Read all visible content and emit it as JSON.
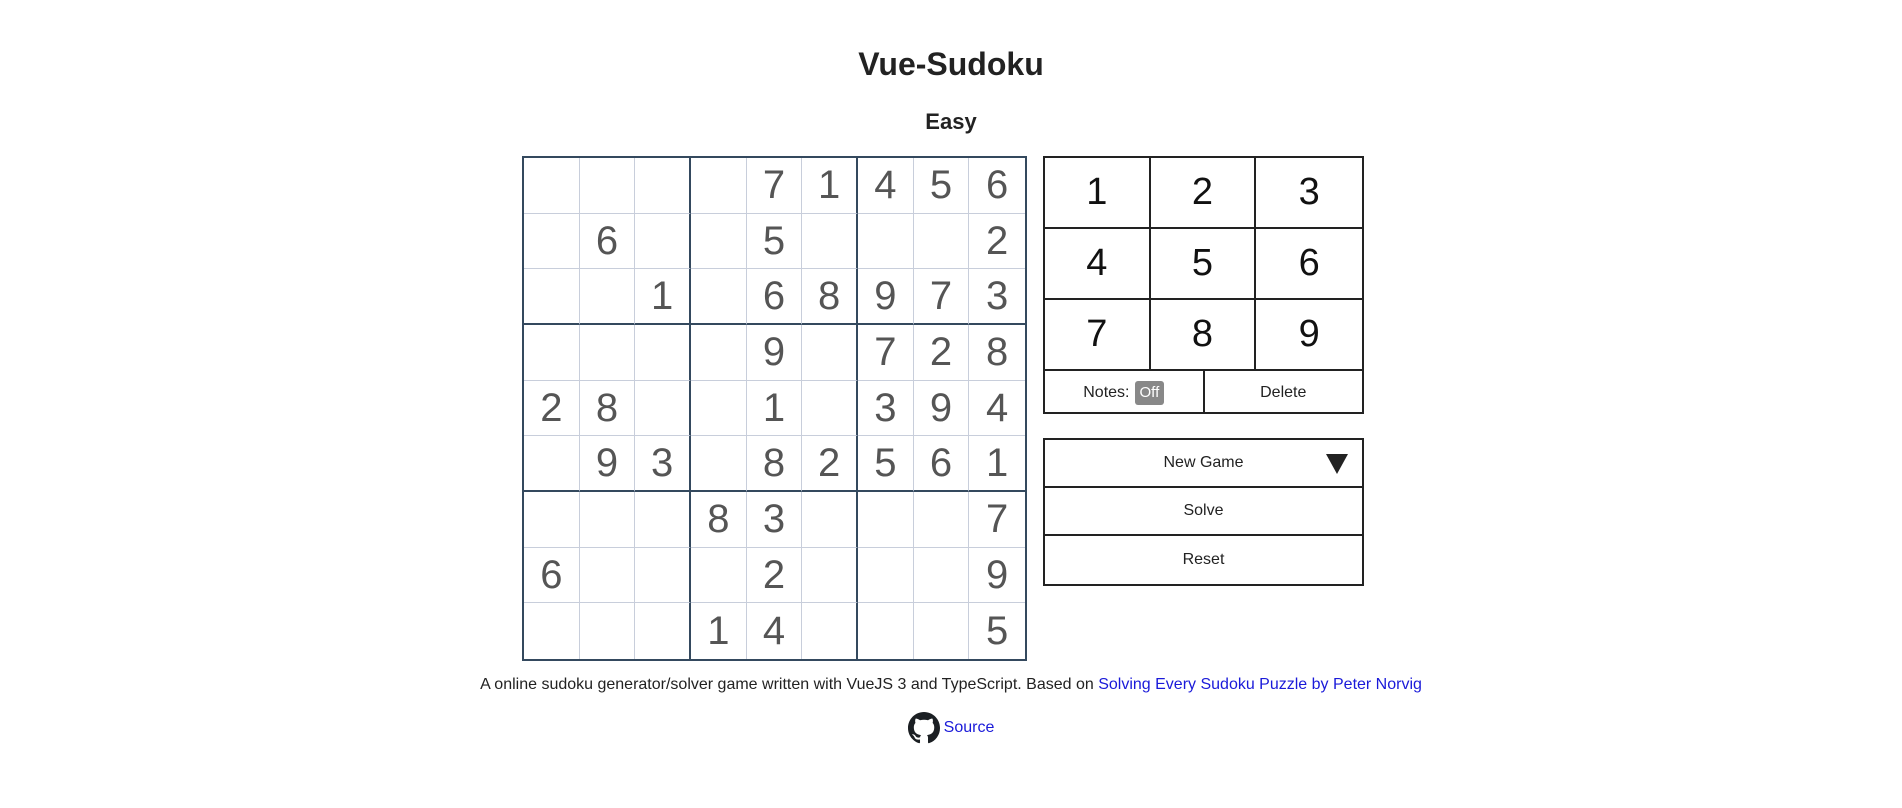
{
  "app": {
    "title": "Vue-Sudoku",
    "difficulty": "Easy"
  },
  "board": [
    [
      "",
      "",
      "",
      "",
      "7",
      "1",
      "4",
      "5",
      "6"
    ],
    [
      "",
      "6",
      "",
      "",
      "5",
      "",
      "",
      "",
      "2"
    ],
    [
      "",
      "",
      "1",
      "",
      "6",
      "8",
      "9",
      "7",
      "3"
    ],
    [
      "",
      "",
      "",
      "",
      "9",
      "",
      "7",
      "2",
      "8"
    ],
    [
      "2",
      "8",
      "",
      "",
      "1",
      "",
      "3",
      "9",
      "4"
    ],
    [
      "",
      "9",
      "3",
      "",
      "8",
      "2",
      "5",
      "6",
      "1"
    ],
    [
      "",
      "",
      "",
      "8",
      "3",
      "",
      "",
      "",
      "7"
    ],
    [
      "6",
      "",
      "",
      "",
      "2",
      "",
      "",
      "",
      "9"
    ],
    [
      "",
      "",
      "",
      "1",
      "4",
      "",
      "",
      "",
      "5"
    ]
  ],
  "numpad": {
    "numbers": [
      "1",
      "2",
      "3",
      "4",
      "5",
      "6",
      "7",
      "8",
      "9"
    ],
    "notes_label": "Notes:",
    "notes_state": "Off",
    "delete_label": "Delete"
  },
  "actions": {
    "new_game": "New Game",
    "solve": "Solve",
    "reset": "Reset"
  },
  "footer": {
    "description": "A online sudoku generator/solver game written with VueJS 3 and TypeScript. Based on ",
    "link_text": "Solving Every Sudoku Puzzle by Peter Norvig",
    "source_label": "Source",
    "source_icon": "github-icon"
  },
  "colors": {
    "grid_border": "#34495e",
    "cell_line": "#c8cedb",
    "digit": "#555555",
    "link": "#1a1ad9",
    "toggle_bg": "#888888"
  }
}
